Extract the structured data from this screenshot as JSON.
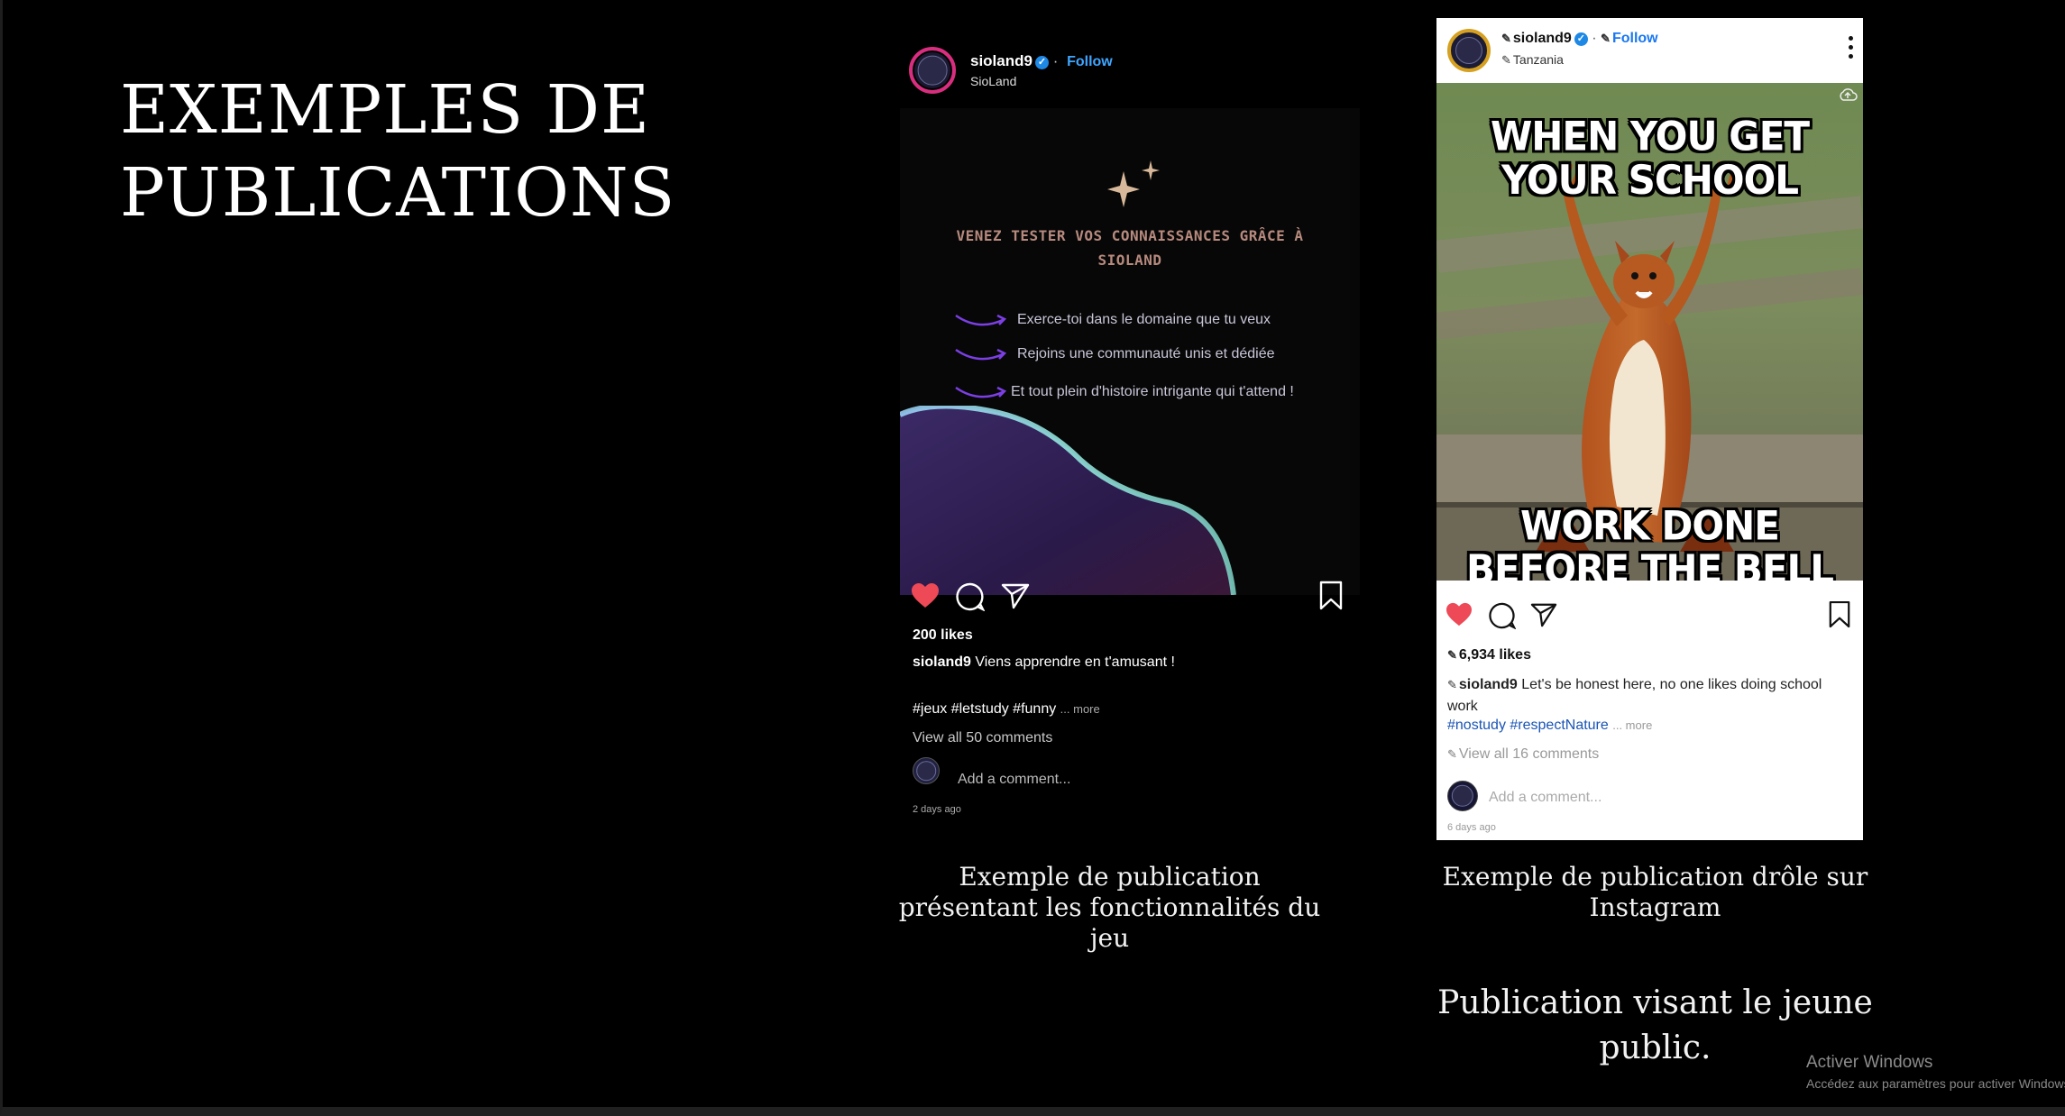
{
  "slide": {
    "title_line1": "EXEMPLES DE",
    "title_line2": "PUBLICATIONS"
  },
  "post_dark": {
    "username": "sioland9",
    "follow": "Follow",
    "subtitle": "SioLand",
    "headline": "VENEZ TESTER VOS CONNAISSANCES GRÂCE À SIOLAND",
    "features": [
      "Exerce-toi dans le domaine que tu veux",
      "Rejoins une communauté unis et dédiée",
      "Et tout plein d'histoire intrigante qui t'attend !"
    ],
    "likes": "200 likes",
    "caption_user": "sioland9",
    "caption_text": "Viens apprendre en t'amusant !",
    "tags": "#jeux #letstudy #funny",
    "more": "... more",
    "view_all": "View all 50 comments",
    "add_comment": "Add a comment...",
    "time": "2 days ago",
    "liked_color": "#ed4956",
    "accent_arrow_color": "#7b3fe4"
  },
  "post_light": {
    "username": "sioland9",
    "follow": "Follow",
    "location": "Tanzania",
    "meme_top": "WHEN YOU GET YOUR SCHOOL",
    "meme_bottom": "WORK DONE BEFORE THE BELL",
    "likes": "6,934 likes",
    "caption_user": "sioland9",
    "caption_text": "Let's be honest here, no one likes doing school work",
    "tag1": "#nostudy",
    "tag2": "#respectNature",
    "more": "... more",
    "view_all": "View all 16 comments",
    "add_comment": "Add a comment...",
    "time": "6 days ago",
    "liked_color": "#ed4956"
  },
  "captions": {
    "caption1": "Exemple de publication présentant les fonctionnalités du jeu",
    "caption2": "Exemple de publication drôle sur Instagram",
    "caption3": "Publication visant le jeune public."
  },
  "watermark": {
    "title": "Activer Windows",
    "subtitle": "Accédez aux paramètres pour activer Windows."
  }
}
